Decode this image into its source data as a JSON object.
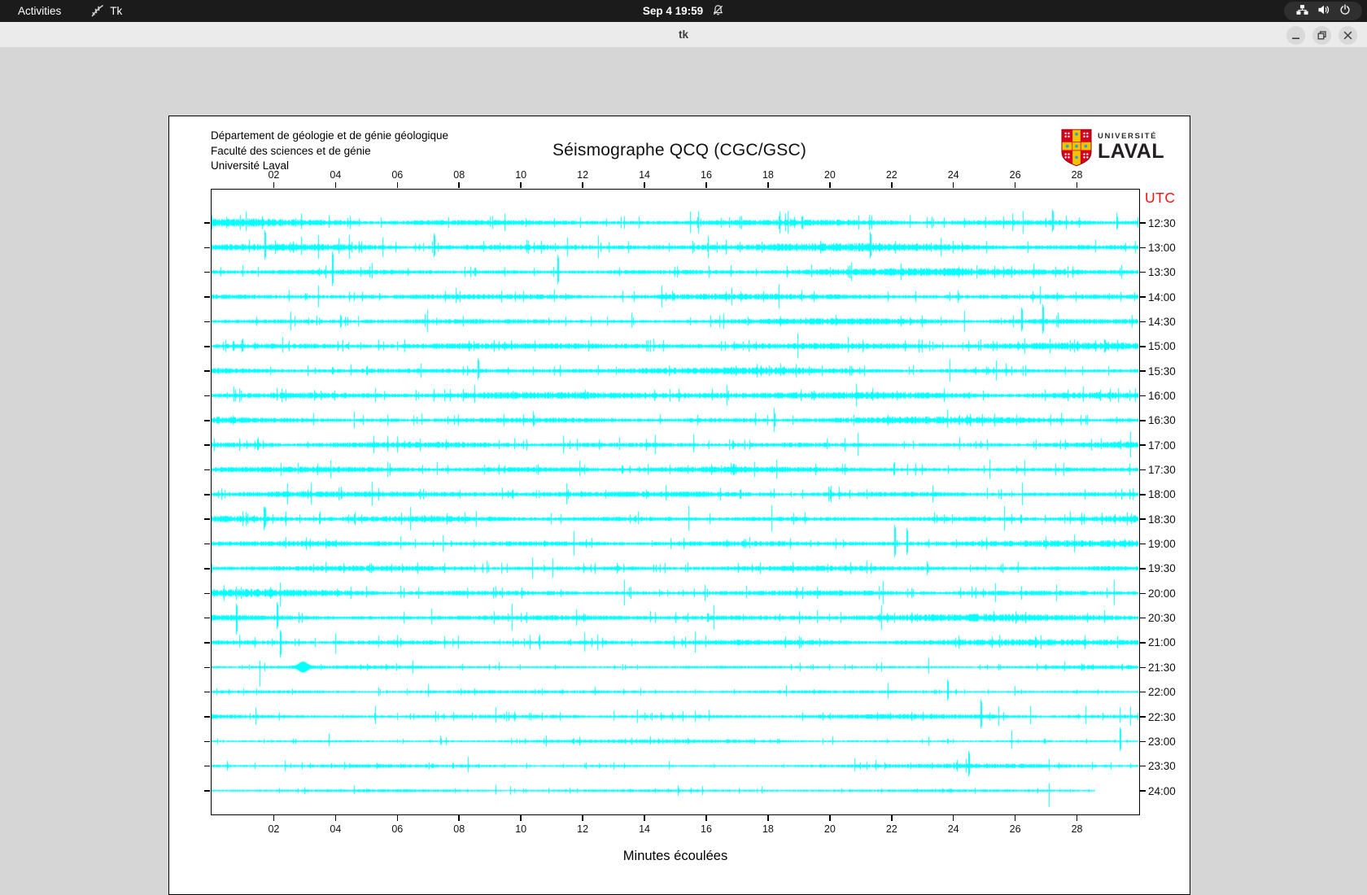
{
  "topbar": {
    "activities": "Activities",
    "app_label": "Tk",
    "clock": "Sep 4  19:59"
  },
  "titlebar": {
    "title": "tk",
    "buttons": [
      "minimize",
      "restore",
      "close"
    ]
  },
  "panel": {
    "header_lines": [
      "Département de géologie et de génie géologique",
      "Faculté des sciences et de génie",
      "Université Laval"
    ],
    "title": "Séismographe QCQ (CGC/GSC)",
    "logo": {
      "line1": "UNIVERSITÉ",
      "line2": "LAVAL"
    }
  },
  "colors": {
    "trace": "#00ffff",
    "utc_label": "#fb0f0f",
    "panel_bg": "#ffffff",
    "window_bg": "#d6d6d6",
    "topbar_bg": "#1b1b1b",
    "titlebar_bg": "#ebebeb"
  },
  "chart_data": {
    "type": "line",
    "variant": "seismograph-helicorder",
    "title": "Séismographe QCQ (CGC/GSC)",
    "xlabel": "Minutes écoulées",
    "right_axis_label": "UTC",
    "x_range": [
      0,
      30
    ],
    "x_ticks": [
      "02",
      "04",
      "06",
      "08",
      "10",
      "12",
      "14",
      "16",
      "18",
      "20",
      "22",
      "24",
      "26",
      "28"
    ],
    "grid": false,
    "trace_color": "#00ffff",
    "rows": [
      {
        "utc": "12:30",
        "amp": 3.0,
        "spikes": [
          [
            1.1,
            14
          ],
          [
            2.9,
            11
          ],
          [
            3.8,
            9
          ],
          [
            9.0,
            7
          ],
          [
            22.6,
            9
          ],
          [
            27.2,
            16
          ],
          [
            29.3,
            12
          ]
        ]
      },
      {
        "utc": "13:00",
        "amp": 3.0,
        "spikes": [
          [
            1.2,
            9
          ],
          [
            1.7,
            21
          ],
          [
            2.9,
            13
          ],
          [
            4.1,
            11
          ],
          [
            7.2,
            17
          ],
          [
            8.8,
            8
          ],
          [
            10.2,
            9
          ],
          [
            21.3,
            19
          ],
          [
            23.6,
            11
          ],
          [
            28.6,
            9
          ]
        ]
      },
      {
        "utc": "13:30",
        "amp": 2.8,
        "spikes": [
          [
            1.0,
            8
          ],
          [
            3.9,
            25,
            17
          ],
          [
            5.2,
            11
          ],
          [
            11.2,
            21
          ],
          [
            16.8,
            8
          ],
          [
            19.4,
            9
          ],
          [
            26.6,
            10
          ]
        ]
      },
      {
        "utc": "14:00",
        "amp": 2.4,
        "spikes": [
          [
            2.5,
            8
          ],
          [
            7.9,
            11
          ],
          [
            11.1,
            9
          ],
          [
            14.9,
            7
          ],
          [
            19.1,
            8
          ],
          [
            26.8,
            13
          ]
        ]
      },
      {
        "utc": "14:30",
        "amp": 2.6,
        "spikes": [
          [
            3.4,
            7
          ],
          [
            6.9,
            9
          ],
          [
            13.6,
            11
          ],
          [
            20.2,
            8
          ],
          [
            26.2,
            17
          ],
          [
            26.9,
            21
          ],
          [
            27.4,
            11
          ]
        ]
      },
      {
        "utc": "15:00",
        "amp": 2.9,
        "spikes": [
          [
            1.0,
            9
          ],
          [
            2.3,
            11
          ],
          [
            5.4,
            8
          ],
          [
            9.7,
            7
          ],
          [
            14.3,
            9
          ],
          [
            20.6,
            11
          ],
          [
            24.9,
            8
          ]
        ]
      },
      {
        "utc": "15:30",
        "amp": 2.5,
        "spikes": [
          [
            4.5,
            8
          ],
          [
            8.6,
            15
          ],
          [
            12.5,
            7
          ],
          [
            18.4,
            9
          ],
          [
            22.7,
            7
          ],
          [
            25.7,
            9
          ]
        ]
      },
      {
        "utc": "16:00",
        "amp": 3.0,
        "spikes": [
          [
            0.7,
            11
          ],
          [
            2.1,
            9
          ],
          [
            8.5,
            13
          ],
          [
            12.1,
            7
          ],
          [
            16.2,
            8
          ],
          [
            21.4,
            9
          ],
          [
            28.2,
            11
          ]
        ]
      },
      {
        "utc": "16:30",
        "amp": 2.9,
        "spikes": [
          [
            3.3,
            9
          ],
          [
            6.8,
            8
          ],
          [
            10.4,
            11
          ],
          [
            14.5,
            7
          ],
          [
            17.6,
            9
          ],
          [
            23.8,
            13
          ],
          [
            27.5,
            9
          ]
        ]
      },
      {
        "utc": "17:00",
        "amp": 2.8,
        "spikes": [
          [
            1.5,
            9
          ],
          [
            5.7,
            11
          ],
          [
            9.8,
            8
          ],
          [
            13.2,
            9
          ],
          [
            15.6,
            13
          ],
          [
            19.9,
            8
          ],
          [
            24.2,
            9
          ],
          [
            28.8,
            8
          ]
        ]
      },
      {
        "utc": "17:30",
        "amp": 2.9,
        "spikes": [
          [
            2.8,
            8
          ],
          [
            7.3,
            9
          ],
          [
            11.9,
            11
          ],
          [
            16.8,
            8
          ],
          [
            20.4,
            7
          ],
          [
            22.1,
            9
          ],
          [
            26.3,
            11
          ]
        ]
      },
      {
        "utc": "18:00",
        "amp": 2.5,
        "spikes": [
          [
            4.2,
            9
          ],
          [
            9.4,
            8
          ],
          [
            14.7,
            11
          ],
          [
            18.2,
            7
          ],
          [
            20.3,
            9
          ],
          [
            25.1,
            8
          ]
        ]
      },
      {
        "utc": "18:30",
        "amp": 2.9,
        "spikes": [
          [
            1.7,
            15
          ],
          [
            3.5,
            9
          ],
          [
            8.2,
            8
          ],
          [
            13.8,
            9
          ],
          [
            19.2,
            8
          ],
          [
            23.4,
            8
          ],
          [
            27.8,
            9
          ]
        ]
      },
      {
        "utc": "19:00",
        "amp": 2.6,
        "spikes": [
          [
            2.4,
            8
          ],
          [
            6.1,
            9
          ],
          [
            12.3,
            7
          ],
          [
            17.4,
            8
          ],
          [
            22.1,
            23
          ],
          [
            22.5,
            19
          ],
          [
            27.0,
            9
          ]
        ]
      },
      {
        "utc": "19:30",
        "amp": 2.4,
        "spikes": [
          [
            3.7,
            8
          ],
          [
            8.9,
            9
          ],
          [
            15.4,
            7
          ],
          [
            18.8,
            8
          ],
          [
            21.2,
            9
          ],
          [
            26.1,
            8
          ]
        ]
      },
      {
        "utc": "20:00",
        "amp": 2.8,
        "spikes": [
          [
            2.2,
            13,
            17
          ],
          [
            5.0,
            8
          ],
          [
            6.1,
            9
          ],
          [
            9.2,
            8
          ],
          [
            13.5,
            7
          ],
          [
            17.3,
            9
          ],
          [
            24.6,
            8
          ]
        ]
      },
      {
        "utc": "20:30",
        "amp": 2.9,
        "spikes": [
          [
            0.8,
            17,
            21
          ],
          [
            2.1,
            19
          ],
          [
            7.1,
            11
          ],
          [
            14.2,
            8
          ],
          [
            19.6,
            9
          ],
          [
            25.3,
            8
          ],
          [
            28.9,
            9
          ]
        ]
      },
      {
        "utc": "21:00",
        "amp": 2.7,
        "spikes": [
          [
            0.9,
            9
          ],
          [
            2.2,
            15,
            19
          ],
          [
            4.0,
            11,
            14
          ],
          [
            5.4,
            8
          ],
          [
            6.0,
            9
          ],
          [
            10.6,
            7
          ],
          [
            16.0,
            8
          ],
          [
            25.5,
            9
          ]
        ]
      },
      {
        "utc": "21:30",
        "amp": 1.5,
        "blob": 2.95,
        "spikes": [
          [
            1.55,
            8,
            24
          ],
          [
            9.3,
            6
          ],
          [
            23.2,
            11
          ],
          [
            27.6,
            7
          ]
        ]
      },
      {
        "utc": "22:00",
        "amp": 1.3,
        "spikes": [
          [
            7.0,
            9
          ],
          [
            12.4,
            6
          ],
          [
            18.6,
            8
          ],
          [
            21.9,
            11
          ],
          [
            23.8,
            15
          ],
          [
            26.0,
            7
          ]
        ]
      },
      {
        "utc": "22:30",
        "amp": 2.1,
        "spikes": [
          [
            5.3,
            13
          ],
          [
            9.2,
            11
          ],
          [
            13.0,
            7
          ],
          [
            16.1,
            8
          ],
          [
            24.9,
            21
          ],
          [
            26.5,
            13
          ],
          [
            28.3,
            13
          ],
          [
            29.4,
            11
          ]
        ]
      },
      {
        "utc": "23:00",
        "amp": 1.3,
        "spikes": [
          [
            3.8,
            9
          ],
          [
            7.4,
            7
          ],
          [
            14.2,
            6
          ],
          [
            20.1,
            6
          ],
          [
            25.9,
            13
          ],
          [
            29.4,
            17
          ]
        ]
      },
      {
        "utc": "23:30",
        "amp": 1.5,
        "spikes": [
          [
            8.3,
            11
          ],
          [
            14.8,
            6
          ],
          [
            20.8,
            9
          ],
          [
            21.5,
            7
          ],
          [
            24.5,
            18,
            13
          ],
          [
            27.1,
            8
          ]
        ]
      },
      {
        "utc": "24:00",
        "amp": 1.1,
        "end": 28.6,
        "spikes": [
          [
            4.6,
            6
          ],
          [
            9.2,
            7
          ],
          [
            17.8,
            5
          ],
          [
            27.1,
            9,
            20
          ]
        ]
      }
    ]
  }
}
